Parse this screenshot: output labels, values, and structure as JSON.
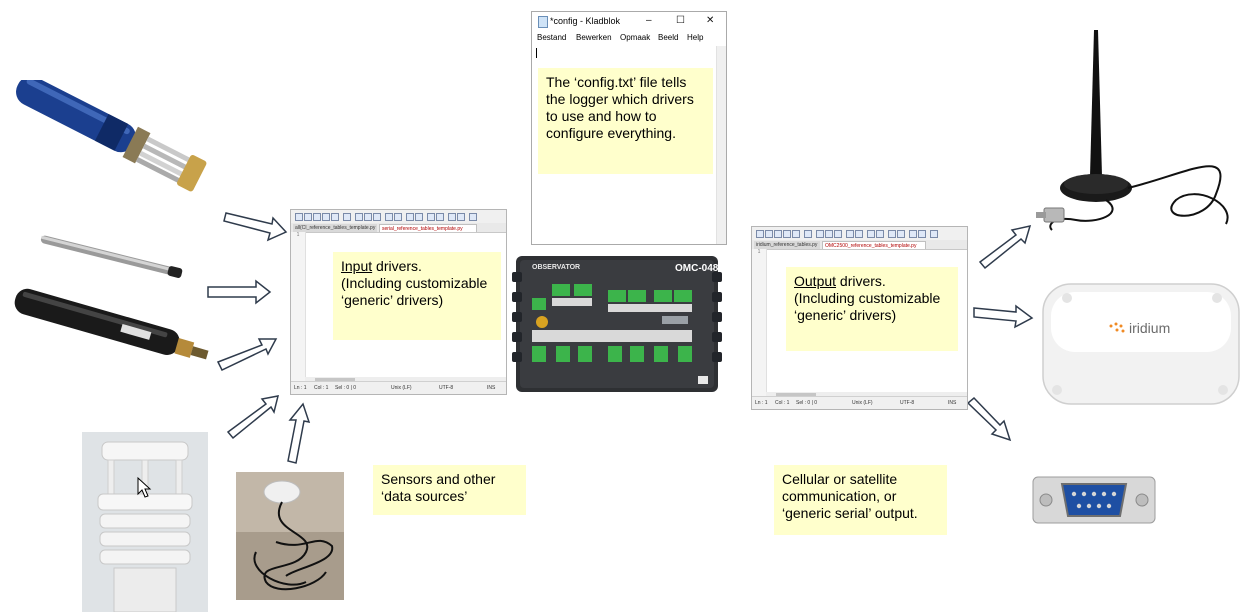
{
  "notepad": {
    "title": "*config - Kladblok",
    "menu": [
      "Bestand",
      "Bewerken",
      "Opmaak",
      "Beeld",
      "Help"
    ],
    "minimize_glyph": "–",
    "maximize_glyph": "☐",
    "close_glyph": "✕",
    "note_text": "The ‘config.txt’ file tells the logger which drivers to use and how to configure everything."
  },
  "input_editor": {
    "tabs": [
      "all(CI_reference_tables_template.py",
      "serial_reference_tables_template.py"
    ],
    "note_text": "(Including customizable ‘generic’ drivers)",
    "note_underlined": "Input",
    "note_rest": " drivers.",
    "status": {
      "ln": "Ln : 1",
      "col": "Col : 1",
      "sel": "Sel : 0 | 0",
      "eol": "Unix (LF)",
      "enc": "UTF-8",
      "mode": "INS"
    }
  },
  "output_editor": {
    "tabs": [
      "iridium_reference_tables.py",
      "OMC2500_reference_tables_template.py"
    ],
    "note_text": "(Including customizable ‘generic’ drivers)",
    "note_underlined": "Output",
    "note_rest": " drivers.",
    "status": {
      "ln": "Ln : 1",
      "col": "Col : 1",
      "sel": "Sel : 0 | 0",
      "eol": "Unix (LF)",
      "enc": "UTF-8",
      "mode": "INS"
    }
  },
  "logger": {
    "brand": "OBSERVATOR",
    "model": "OMC-048"
  },
  "iridium_label": "iridium",
  "sensors_caption": "Sensors and other ‘data sources’",
  "output_caption": "Cellular or satellite communication, or ‘generic serial’ output.",
  "colors": {
    "note_bg": "#ffffcc",
    "arrow_stroke": "#2f3b4c",
    "logger_body": "#2e3033",
    "terminal_green": "#3cb44b",
    "probe_blue": "#1b3f8f",
    "iridium_orange": "#f08a24"
  }
}
